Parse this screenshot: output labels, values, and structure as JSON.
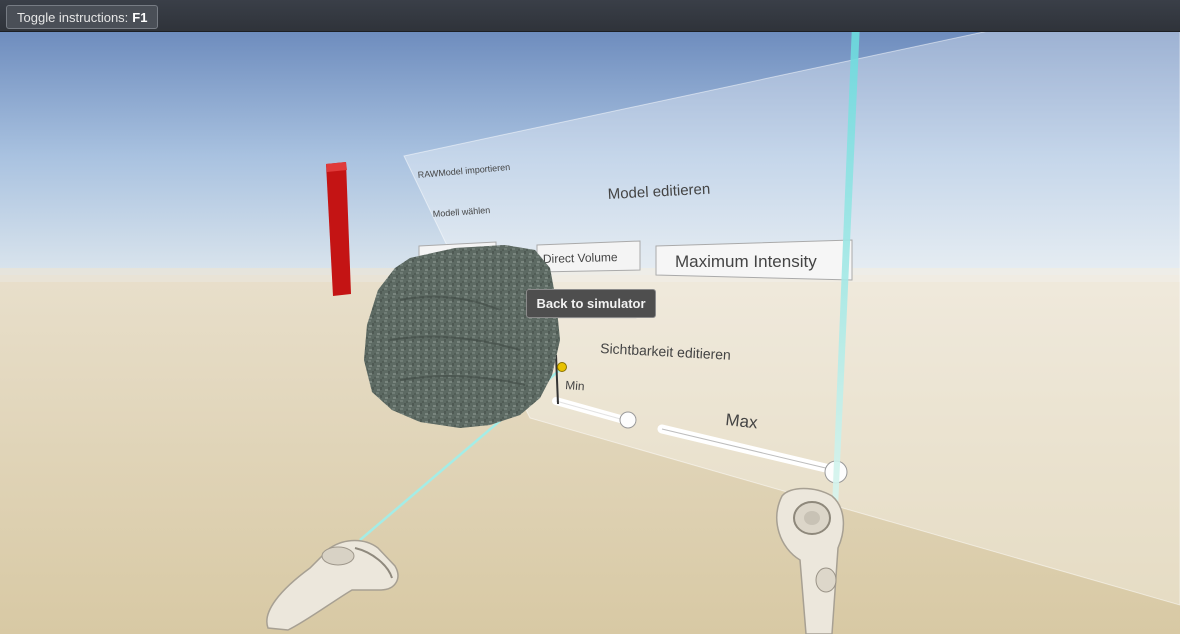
{
  "topbar": {
    "toggle_label": "Toggle instructions:",
    "toggle_key": "F1"
  },
  "panel": {
    "import_label": "RAWModel importieren",
    "choose_label": "Modell wählen",
    "edit_title": "Model editieren",
    "direct_volume_button": "Direct Volume",
    "max_intensity_button": "Maximum Intensity",
    "visibility_title": "Sichtbarkeit editieren",
    "min_label": "Min",
    "max_label": "Max"
  },
  "overlay": {
    "back_button": "Back to simulator"
  },
  "colors": {
    "sky_top": "#5f7fb5",
    "ground": "#dccfae",
    "laser": "#7fe6e6",
    "red_pillar": "#c41414",
    "volume_model": "#5f6b65"
  }
}
